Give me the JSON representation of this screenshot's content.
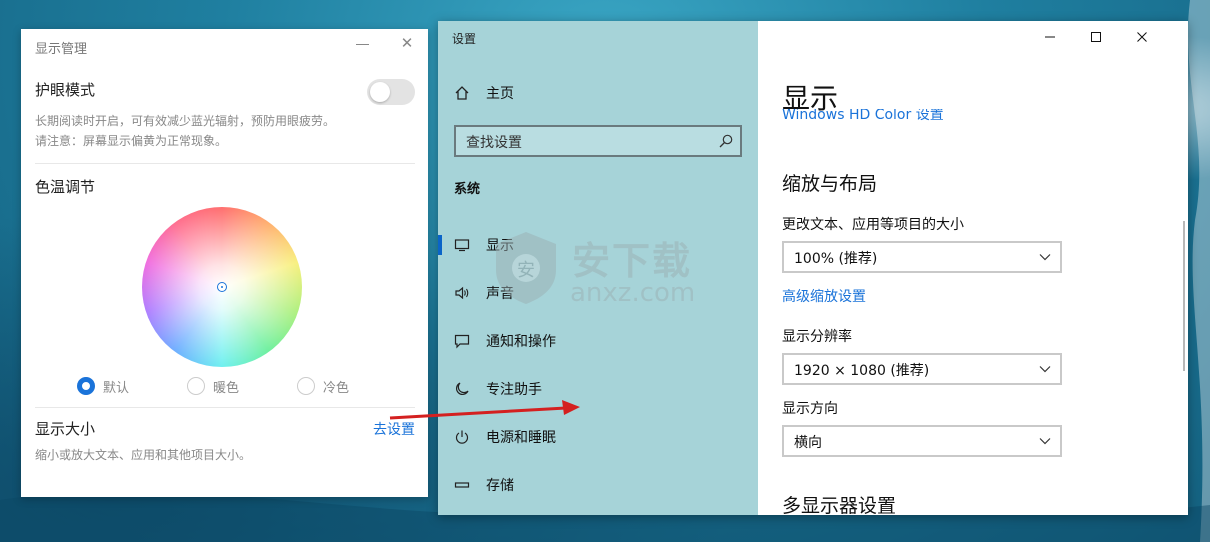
{
  "display_manager": {
    "title": "显示管理",
    "close_glyph": "✕",
    "eye_mode": {
      "title": "护眼模式",
      "enabled": false,
      "desc_line1": "长期阅读时开启，可有效减少蓝光辐射，预防用眼疲劳。",
      "desc_line2": "请注意：屏幕显示偏黄为正常现象。"
    },
    "color_temp": {
      "title": "色温调节",
      "options": [
        {
          "label": "默认",
          "selected": true
        },
        {
          "label": "暖色",
          "selected": false
        },
        {
          "label": "冷色",
          "selected": false
        }
      ]
    },
    "display_size": {
      "title": "显示大小",
      "link": "去设置",
      "desc": "缩小或放大文本、应用和其他项目大小。"
    }
  },
  "settings": {
    "app_title": "设置",
    "nav": {
      "home": "主页",
      "search_placeholder": "查找设置",
      "section": "系统",
      "items": [
        {
          "label": "显示",
          "icon": "monitor-icon",
          "selected": true
        },
        {
          "label": "声音",
          "icon": "speaker-icon",
          "selected": false
        },
        {
          "label": "通知和操作",
          "icon": "notification-icon",
          "selected": false
        },
        {
          "label": "专注助手",
          "icon": "moon-icon",
          "selected": false
        },
        {
          "label": "电源和睡眠",
          "icon": "power-icon",
          "selected": false
        },
        {
          "label": "存储",
          "icon": "storage-icon",
          "selected": false
        }
      ]
    },
    "content": {
      "page_title": "显示",
      "hd_color_link": "Windows HD Color 设置",
      "scale_section": "缩放与布局",
      "text_size_label": "更改文本、应用等项目的大小",
      "text_size_value": "100% (推荐)",
      "advanced_scaling_link": "高级缩放设置",
      "resolution_label": "显示分辨率",
      "resolution_value": "1920 × 1080 (推荐)",
      "orientation_label": "显示方向",
      "orientation_value": "横向",
      "multi_display_section": "多显示器设置"
    }
  },
  "watermark": {
    "cn": "安下载",
    "en": "anxz.com",
    "badge": "安"
  },
  "colors": {
    "accent": "#1a73d9",
    "sidebar_bg": "#a6d3d8",
    "arrow": "#d42020"
  }
}
